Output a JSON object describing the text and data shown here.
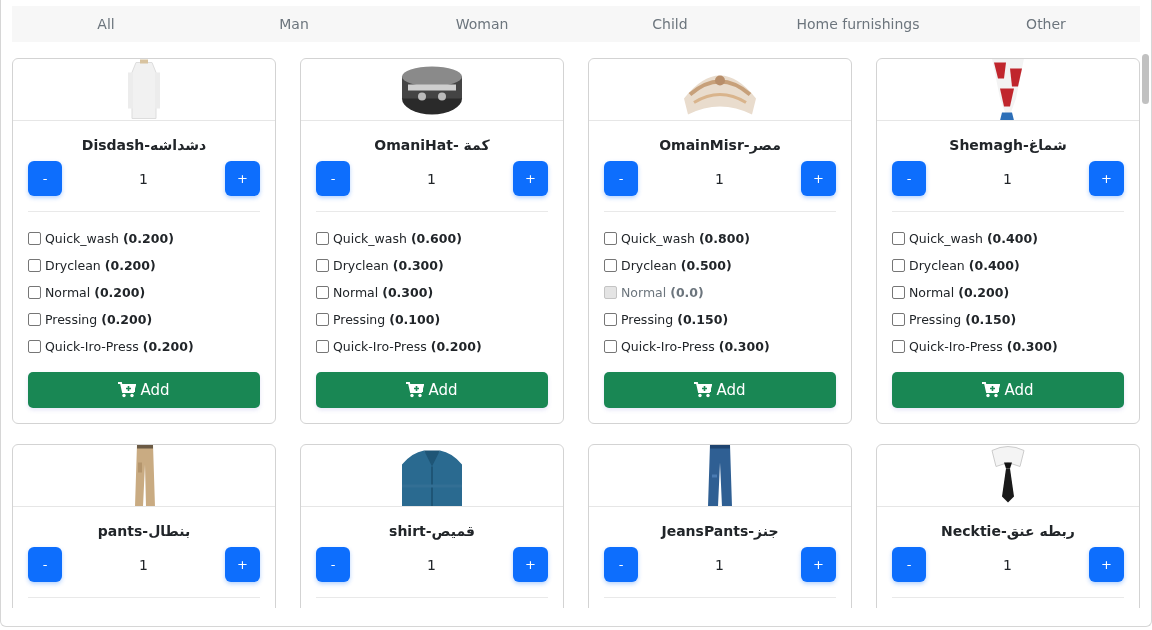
{
  "tabs": [
    {
      "label": "All",
      "selected": false
    },
    {
      "label": "Man",
      "selected": false
    },
    {
      "label": "Woman",
      "selected": false
    },
    {
      "label": "Child",
      "selected": false
    },
    {
      "label": "Home furnishings",
      "selected": false
    },
    {
      "label": "Other",
      "selected": false
    }
  ],
  "products": [
    {
      "title": "Disdash-دشداشه",
      "minus": "-",
      "quantity": "1",
      "plus": "+",
      "options": [
        {
          "text": "Quick_wash **(0.200)**",
          "checked": false,
          "disabled": false
        },
        {
          "text": "Dryclean **(0.200)**",
          "checked": false,
          "disabled": false
        },
        {
          "text": "Normal **(0.200)**",
          "checked": false,
          "disabled": false
        },
        {
          "text": "Pressing **(0.200)**",
          "checked": false,
          "disabled": false
        },
        {
          "text": "Quick-Iro-Press **(0.200)**",
          "checked": false,
          "disabled": false
        }
      ],
      "add_label": "Add"
    },
    {
      "title": "OmaniHat- كمة",
      "minus": "-",
      "quantity": "1",
      "plus": "+",
      "options": [
        {
          "text": "Quick_wash **(0.600)**",
          "checked": false,
          "disabled": false
        },
        {
          "text": "Dryclean **(0.300)**",
          "checked": false,
          "disabled": false
        },
        {
          "text": "Normal **(0.300)**",
          "checked": false,
          "disabled": false
        },
        {
          "text": "Pressing **(0.100)**",
          "checked": false,
          "disabled": false
        },
        {
          "text": "Quick-Iro-Press **(0.200)**",
          "checked": false,
          "disabled": false
        }
      ],
      "add_label": "Add"
    },
    {
      "title": "OmainMisr-مصر",
      "minus": "-",
      "quantity": "1",
      "plus": "+",
      "options": [
        {
          "text": "Quick_wash **(0.800)**",
          "checked": false,
          "disabled": false
        },
        {
          "text": "Dryclean **(0.500)**",
          "checked": false,
          "disabled": false
        },
        {
          "text": "Normal **(0.0)**",
          "checked": false,
          "disabled": true
        },
        {
          "text": "Pressing **(0.150)**",
          "checked": false,
          "disabled": false
        },
        {
          "text": "Quick-Iro-Press **(0.300)**",
          "checked": false,
          "disabled": false
        }
      ],
      "add_label": "Add"
    },
    {
      "title": "Shemagh-شماغ",
      "minus": "-",
      "quantity": "1",
      "plus": "+",
      "options": [
        {
          "text": "Quick_wash **(0.400)**",
          "checked": false,
          "disabled": false
        },
        {
          "text": "Dryclean **(0.400)**",
          "checked": false,
          "disabled": false
        },
        {
          "text": "Normal **(0.200)**",
          "checked": false,
          "disabled": false
        },
        {
          "text": "Pressing **(0.150)**",
          "checked": false,
          "disabled": false
        },
        {
          "text": "Quick-Iro-Press **(0.300)**",
          "checked": false,
          "disabled": false
        }
      ],
      "add_label": "Add"
    },
    {
      "title": "pants-بنطال",
      "minus": "-",
      "quantity": "1",
      "plus": "+"
    },
    {
      "title": "shirt-قميص",
      "minus": "-",
      "quantity": "1",
      "plus": "+"
    },
    {
      "title": "JeansPants-جنز",
      "minus": "-",
      "quantity": "1",
      "plus": "+"
    },
    {
      "title": "Necktie-ربطه عنق",
      "minus": "-",
      "quantity": "1",
      "plus": "+"
    }
  ]
}
